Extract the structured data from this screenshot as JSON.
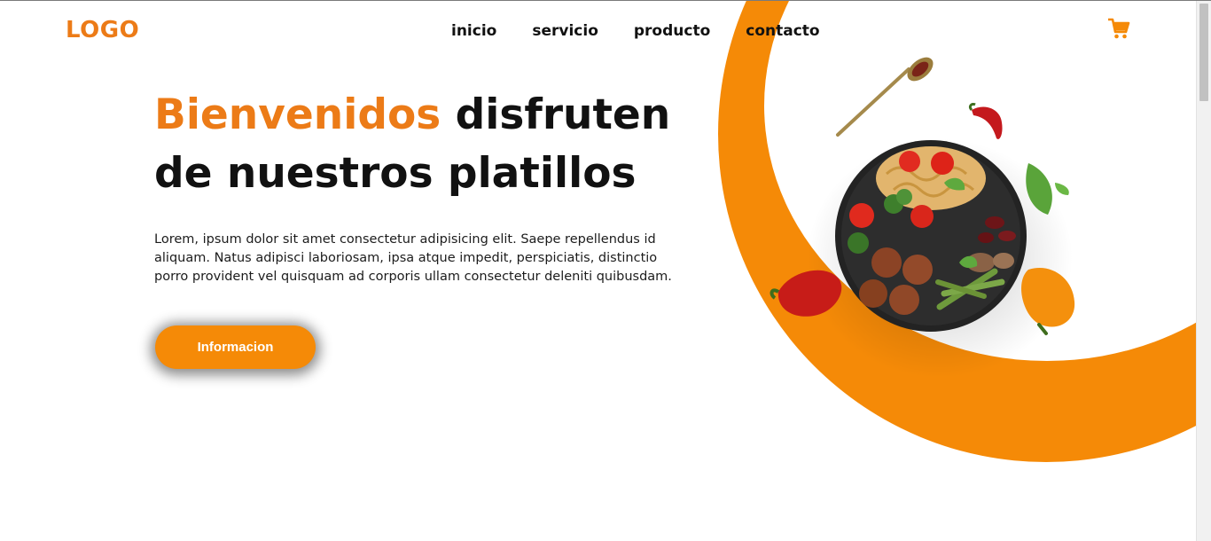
{
  "header": {
    "logo": "LOGO",
    "nav": [
      "inicio",
      "servicio",
      "producto",
      "contacto"
    ],
    "cart_icon": "shopping-cart-icon"
  },
  "hero": {
    "title_accent": "Bienvenidos",
    "title_rest": "disfruten de nuestros platillos",
    "paragraph": "Lorem, ipsum dolor sit amet consectetur adipisicing elit. Saepe repellendus id aliquam. Natus adipisci laboriosam, ipsa atque impedit, perspiciatis, distinctio porro provident vel quisquam ad corporis ullam consectetur deleniti quibusdam.",
    "button_label": "Informacion"
  },
  "colors": {
    "accent": "#f58a07",
    "logo": "#ec7b17",
    "text": "#111111"
  }
}
